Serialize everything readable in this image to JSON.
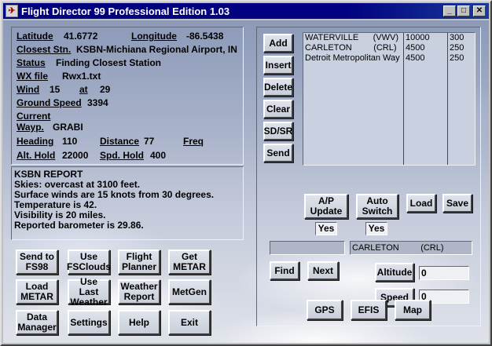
{
  "window": {
    "title": "Flight Director 99 Professional Edition 1.03",
    "minimize": "_",
    "maximize": "□",
    "close": "✕"
  },
  "info": {
    "latitude_label": "Latitude",
    "latitude_value": "41.6772",
    "longitude_label": "Longitude",
    "longitude_value": "-86.5438",
    "closest_label": "Closest Stn.",
    "closest_value": "KSBN-Michiana Regional Airport, IN",
    "status_label": "Status",
    "status_value": "Finding Closest Station",
    "wxfile_label": "WX file",
    "wxfile_value": "Rwx1.txt",
    "wind_label": "Wind",
    "wind_value": "15",
    "at_label": "at",
    "at_value": "29",
    "groundspeed_label": "Ground Speed",
    "groundspeed_value": "3394",
    "current_label": "Current",
    "waypoint_label": "Wayp.",
    "waypoint_value": "GRABI",
    "heading_label": "Heading",
    "heading_value": "110",
    "distance_label": "Distance",
    "distance_value": "77",
    "freq_label": "Freq",
    "althold_label": "Alt. Hold",
    "althold_value": "22000",
    "spdhold_label": "Spd. Hold",
    "spdhold_value": "400"
  },
  "report": {
    "lines": [
      "KSBN REPORT",
      "Skies: overcast at 3100 feet.",
      "Surface winds are 15 knots from 30 degrees.",
      "Temperature is 42.",
      "Visibility is 20 miles.",
      "Reported barometer is 29.86."
    ]
  },
  "buttons": {
    "send_fs98": [
      "Send to",
      "FS98"
    ],
    "use_fsclouds": [
      "Use",
      "FSClouds"
    ],
    "flight_planner": [
      "Flight",
      "Planner"
    ],
    "get_metar": [
      "Get",
      "METAR"
    ],
    "load_metar": [
      "Load",
      "METAR"
    ],
    "use_last_weather": [
      "Use Last",
      "Weather"
    ],
    "weather_report": [
      "Weather",
      "Report"
    ],
    "metgen": "MetGen",
    "data_manager": [
      "Data",
      "Manager"
    ],
    "settings": "Settings",
    "help": "Help",
    "exit": "Exit"
  },
  "flightplan": {
    "add": "Add",
    "insert": "Insert",
    "delete": "Delete",
    "clear": "Clear",
    "sdsr": "SD/SR",
    "send": "Send",
    "rows": [
      {
        "name": "WATERVILLE      (VWV)",
        "alt": "10000",
        "spd": "300"
      },
      {
        "name": "CARLETON         (CRL)",
        "alt": "4500",
        "spd": "250"
      },
      {
        "name": "Detroit Metropolitan Way",
        "alt": "4500",
        "spd": "250"
      }
    ],
    "ap_update": [
      "A/P",
      "Update"
    ],
    "ap_update_state": "Yes",
    "auto_switch": [
      "Auto",
      "Switch"
    ],
    "auto_switch_state": "Yes",
    "load": "Load",
    "save": "Save",
    "search_value": "",
    "selected_waypoint": "CARLETON         (CRL)",
    "find": "Find",
    "next": "Next",
    "altitude_label": "Altitude",
    "altitude_value": "0",
    "speed_label": "Speed",
    "speed_value": "0",
    "gps": "GPS",
    "efis": "EFIS",
    "map": "Map"
  }
}
